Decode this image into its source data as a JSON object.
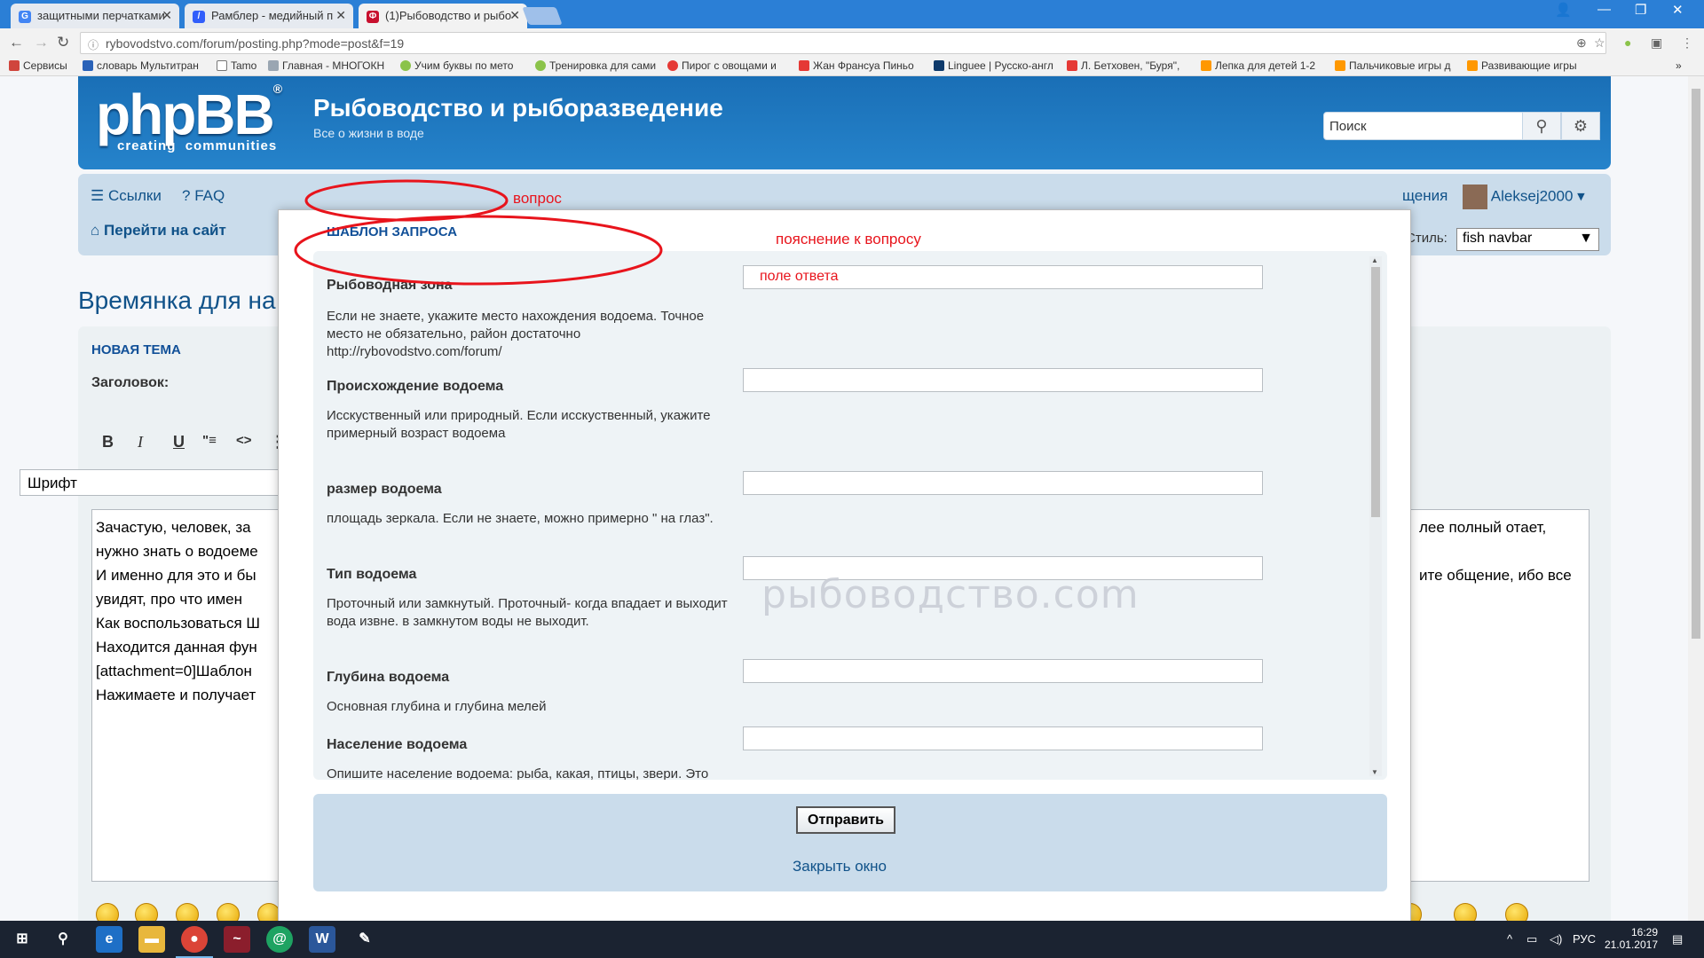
{
  "browser": {
    "tabs": [
      {
        "title": "защитными перчатками",
        "favicon": "G",
        "favicon_color": "#4285f4"
      },
      {
        "title": "Рамблер - медийный п",
        "favicon": "/",
        "favicon_color": "#315efb"
      },
      {
        "title": "(1)Рыбоводство и рыбо",
        "favicon": "Ф",
        "favicon_color": "#c8102e"
      }
    ],
    "url": "rybovodstvo.com/forum/posting.php?mode=post&f=19",
    "bookmarks": [
      {
        "label": "Сервисы",
        "color": "#d0453c"
      },
      {
        "label": "словарь Мультитран",
        "color": "#2a62b8"
      },
      {
        "label": "Tamo",
        "color": "#ffffff"
      },
      {
        "label": "Главная - МНОГОКН",
        "color": "#9aa6b2"
      },
      {
        "label": "Учим буквы по мето",
        "color": "#8bc34a"
      },
      {
        "label": "Тренировка для сами",
        "color": "#8bc34a"
      },
      {
        "label": "Пирог с овощами и",
        "color": "#e53935"
      },
      {
        "label": "Жан Франсуа Пиньо",
        "color": "#e53935"
      },
      {
        "label": "Linguee | Русско-англ",
        "color": "#0e3a6b"
      },
      {
        "label": "Л. Бетховен, \"Буря\",",
        "color": "#e53935"
      },
      {
        "label": "Лепка для детей 1-2",
        "color": "#ff9800"
      },
      {
        "label": "Пальчиковые игры д",
        "color": "#ff9800"
      },
      {
        "label": "Развивающие игры",
        "color": "#ff9800"
      }
    ]
  },
  "forum": {
    "logo": "phpBB",
    "logo_sub_left": "creating",
    "logo_sub_right": "communities",
    "site_title": "Рыбоводство и рыборазведение",
    "site_desc": "Все о жизни в воде",
    "search_placeholder": "Поиск",
    "nav": {
      "links": "Ссылки",
      "faq": "FAQ",
      "go_site": "Перейти на сайт",
      "messages": "щения",
      "user": "Aleksej2000",
      "style_label": "Стиль:",
      "style_value": "fish navbar"
    },
    "page_heading": "Времянка для на",
    "posting": {
      "new_topic": "НОВАЯ ТЕМА",
      "subject_label": "Заголовок:",
      "font_select": "Шрифт",
      "body_lines": [
        "Зачастую, человек, за",
        "нужно знать о водоеме",
        "И именно для это и бы",
        "увидят, про что имен",
        "Как воспользоваться Ш",
        "Находится данная фун",
        "[attachment=0]Шаблон",
        "Нажимаете и получает"
      ],
      "body_right_lines": [
        "лее полный отает,",
        "",
        "ите общение, ибо все"
      ]
    }
  },
  "modal": {
    "title": "ШАБЛОН ЗАПРОСА",
    "questions": [
      {
        "label": "Рыбоводная зона",
        "desc": "Если не знаете, укажите место нахождения водоема. Точное место не обязательно, район достаточно http://rybovodstvo.com/forum/",
        "value": "поле ответа"
      },
      {
        "label": "Происхождение водоема",
        "desc": "Исскуственный или природный. Если исскуственный, укажите примерный возраст водоема",
        "value": ""
      },
      {
        "label": "размер водоема",
        "desc": "площадь зеркала. Если не знаете, можно примерно \" на глаз\".",
        "value": ""
      },
      {
        "label": "Тип водоема",
        "desc": "Проточный или замкнутый. Проточный- когда впадает и выходит вода извне. в замкнутом воды не выходит.",
        "value": ""
      },
      {
        "label": "Глубина водоема",
        "desc": "Основная глубина и глубина мелей",
        "value": ""
      },
      {
        "label": "Население водоема",
        "desc": "Опишите население водоема: рыба, какая, птицы, звери. Это нужно знать, чтобы судить о",
        "value": ""
      }
    ],
    "watermark": "рыбоводство.com",
    "submit": "Отправить",
    "close": "Закрыть окно"
  },
  "annotations": {
    "question": "вопрос",
    "explanation": "пояснение к вопросу",
    "color": "#e8141c"
  },
  "taskbar": {
    "language": "РУС",
    "time": "16:29",
    "date": "21.01.2017"
  }
}
